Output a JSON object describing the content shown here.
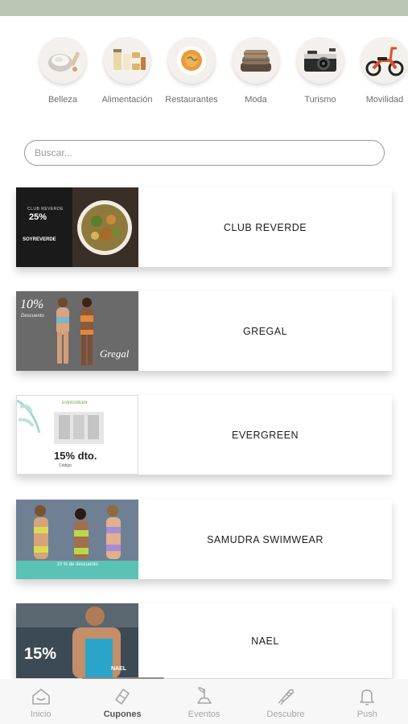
{
  "categories": [
    {
      "label": "Belleza",
      "icon": "beauty-cream-icon"
    },
    {
      "label": "Alimentación",
      "icon": "food-jars-icon"
    },
    {
      "label": "Restaurantes",
      "icon": "soup-bowl-icon"
    },
    {
      "label": "Moda",
      "icon": "folded-clothes-icon"
    },
    {
      "label": "Turismo",
      "icon": "camera-icon"
    },
    {
      "label": "Movilidad",
      "icon": "scooter-icon"
    }
  ],
  "search": {
    "placeholder": "Buscar..."
  },
  "cards": [
    {
      "title": "CLUB REVERDE",
      "thumb": {
        "line1": "CLUB REVERDE",
        "big": "25%",
        "line3": "SOYREVERDE"
      }
    },
    {
      "title": "GREGAL",
      "thumb": {
        "big": "10%",
        "sub": "Descuento",
        "brand": "Gregal"
      }
    },
    {
      "title": "EVERGREEN",
      "thumb": {
        "brand": "EVERGREEN",
        "big": "15% dto.",
        "sub": "Código"
      }
    },
    {
      "title": "SAMUDRA SWIMWEAR",
      "thumb": {
        "band": "10 % de descuento"
      }
    },
    {
      "title": "NAEL",
      "thumb": {
        "big": "15%",
        "brand": "NAEL"
      }
    }
  ],
  "tabs": [
    {
      "label": "Inicio",
      "icon": "home-icon"
    },
    {
      "label": "Cupones",
      "icon": "ticket-icon"
    },
    {
      "label": "Eventos",
      "icon": "event-sprout-icon"
    },
    {
      "label": "Descubre",
      "icon": "rocket-icon"
    },
    {
      "label": "Push",
      "icon": "bell-icon"
    }
  ],
  "colors": {
    "status_bar": "#b9c7b5",
    "card_shadow": "#d8d8d8",
    "accent_teal": "#5bc2b6"
  }
}
